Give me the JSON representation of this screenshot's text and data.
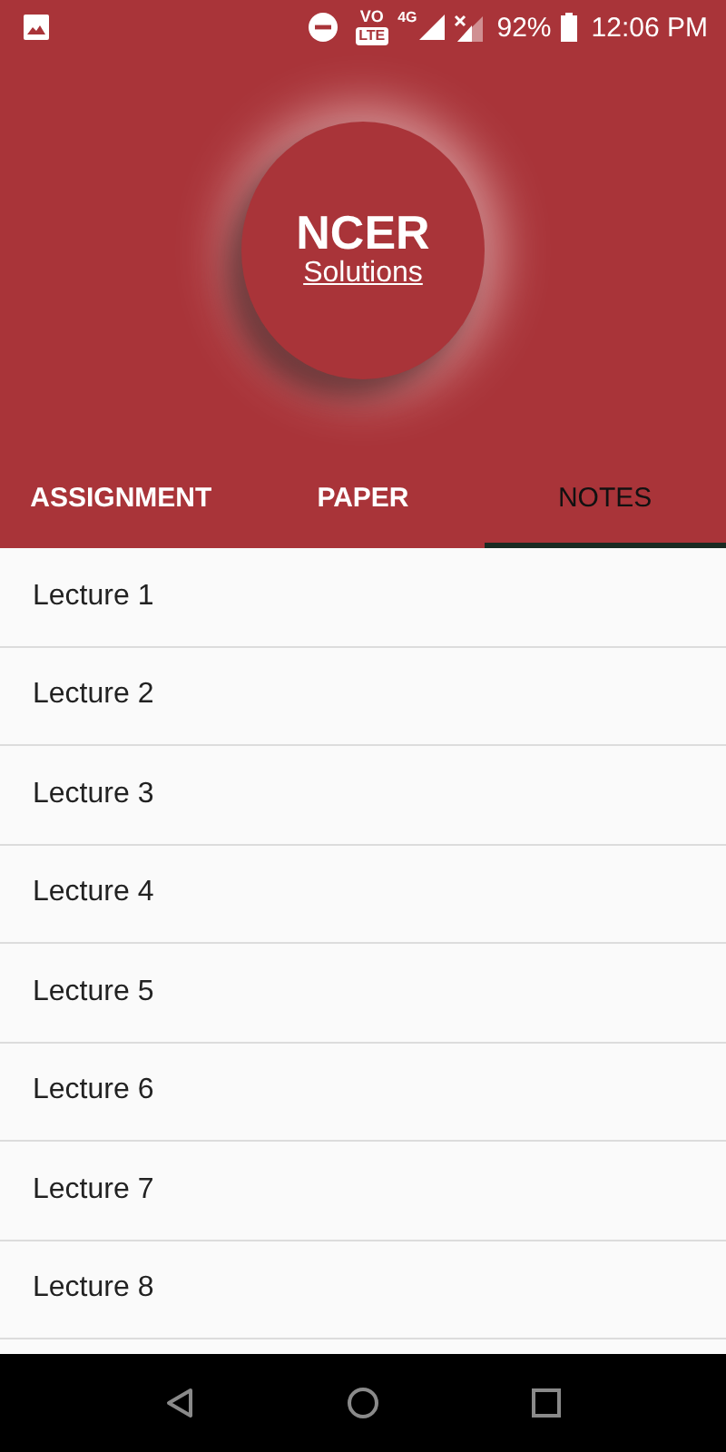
{
  "status_bar": {
    "volte": "VO",
    "lte": "LTE",
    "network": "4G",
    "battery": "92%",
    "time": "12:06 PM"
  },
  "logo": {
    "title": "NCER",
    "subtitle": "Solutions"
  },
  "tabs": [
    {
      "label": "ASSIGNMENT",
      "selected": false
    },
    {
      "label": "PAPER",
      "selected": false
    },
    {
      "label": "NOTES",
      "selected": true
    }
  ],
  "items": [
    "Lecture 1",
    "Lecture 2",
    "Lecture 3",
    "Lecture 4",
    "Lecture 5",
    "Lecture 6",
    "Lecture 7",
    "Lecture 8"
  ]
}
